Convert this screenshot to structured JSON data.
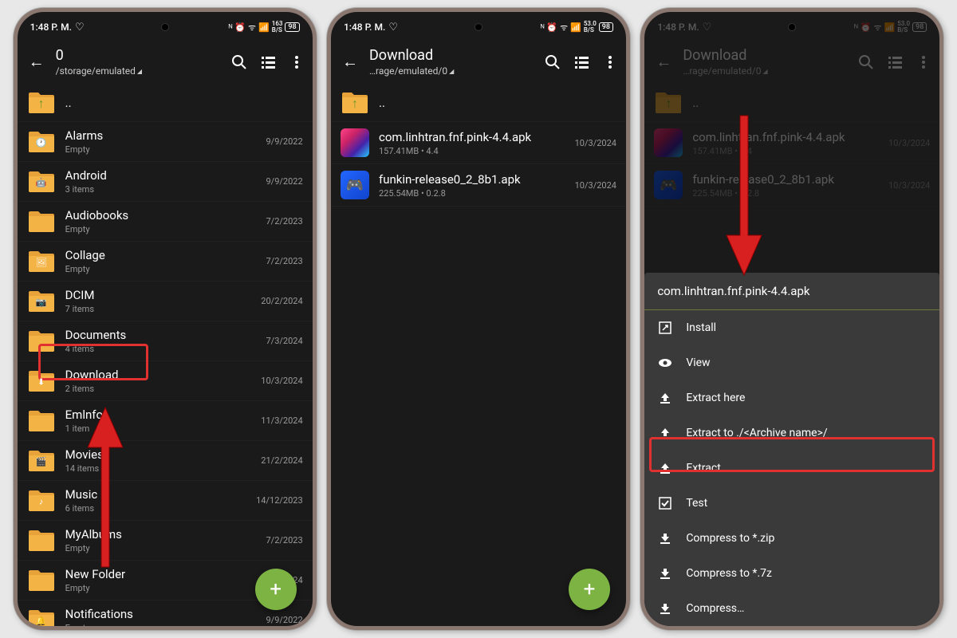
{
  "status": {
    "time": "1:48 P. M.",
    "battery": "98"
  },
  "screen1": {
    "title": "0",
    "path": "/storage/emulated",
    "up": "..",
    "folders": [
      {
        "name": "Alarms",
        "meta": "Empty",
        "date": "9/9/2022",
        "badge": "clock"
      },
      {
        "name": "Android",
        "meta": "3 items",
        "date": "9/9/2022",
        "badge": "android"
      },
      {
        "name": "Audiobooks",
        "meta": "Empty",
        "date": "7/2/2023",
        "badge": ""
      },
      {
        "name": "Collage",
        "meta": "Empty",
        "date": "7/2/2023",
        "badge": "image"
      },
      {
        "name": "DCIM",
        "meta": "7 items",
        "date": "20/2/2024",
        "badge": "camera"
      },
      {
        "name": "Documents",
        "meta": "4 items",
        "date": "7/3/2024",
        "badge": ""
      },
      {
        "name": "Download",
        "meta": "2 items",
        "date": "10/3/2024",
        "badge": "download"
      },
      {
        "name": "Emlnfo",
        "meta": "1 item",
        "date": "11/3/2024",
        "badge": ""
      },
      {
        "name": "Movies",
        "meta": "14 items",
        "date": "21/2/2024",
        "badge": "movie"
      },
      {
        "name": "Music",
        "meta": "6 items",
        "date": "14/12/2023",
        "badge": "music"
      },
      {
        "name": "MyAlbums",
        "meta": "Empty",
        "date": "7/2/2023",
        "badge": ""
      },
      {
        "name": "New Folder",
        "meta": "Empty",
        "date": "7/1/2024",
        "badge": ""
      },
      {
        "name": "Notifications",
        "meta": "Empty",
        "date": "9/9/2022",
        "badge": "bell"
      }
    ]
  },
  "screen2": {
    "title": "Download",
    "path": "…rage/emulated/0",
    "up": "..",
    "files": [
      {
        "name": "com.linhtran.fnf.pink-4.4.apk",
        "meta": "157.41MB   •  4.4",
        "date": "10/3/2024",
        "icon": "pink"
      },
      {
        "name": "funkin-release0_2_8b1.apk",
        "meta": "225.54MB   •  0.2.8",
        "date": "10/3/2024",
        "icon": "blue"
      }
    ]
  },
  "screen3": {
    "title": "Download",
    "path": "…rage/emulated/0",
    "up": "..",
    "files": [
      {
        "name": "com.linhtran.fnf.pink-4.4.apk",
        "meta": "157.41MB   •  4.4",
        "date": "10/3/2024",
        "icon": "pink"
      },
      {
        "name": "funkin-release0_2_8b1.apk",
        "meta": "225.54MB   •  0.2.8",
        "date": "10/3/2024",
        "icon": "blue"
      }
    ],
    "sheet": {
      "header": "com.linhtran.fnf.pink-4.4.apk",
      "items": [
        {
          "label": "Install",
          "icon": "install"
        },
        {
          "label": "View",
          "icon": "view"
        },
        {
          "label": "Extract here",
          "icon": "extract"
        },
        {
          "label": "Extract to ./<Archive name>/",
          "icon": "extract"
        },
        {
          "label": "Extract…",
          "icon": "extract"
        },
        {
          "label": "Test",
          "icon": "test"
        },
        {
          "label": "Compress to *.zip",
          "icon": "compress"
        },
        {
          "label": "Compress to *.7z",
          "icon": "compress"
        },
        {
          "label": "Compress…",
          "icon": "compress"
        }
      ]
    }
  }
}
